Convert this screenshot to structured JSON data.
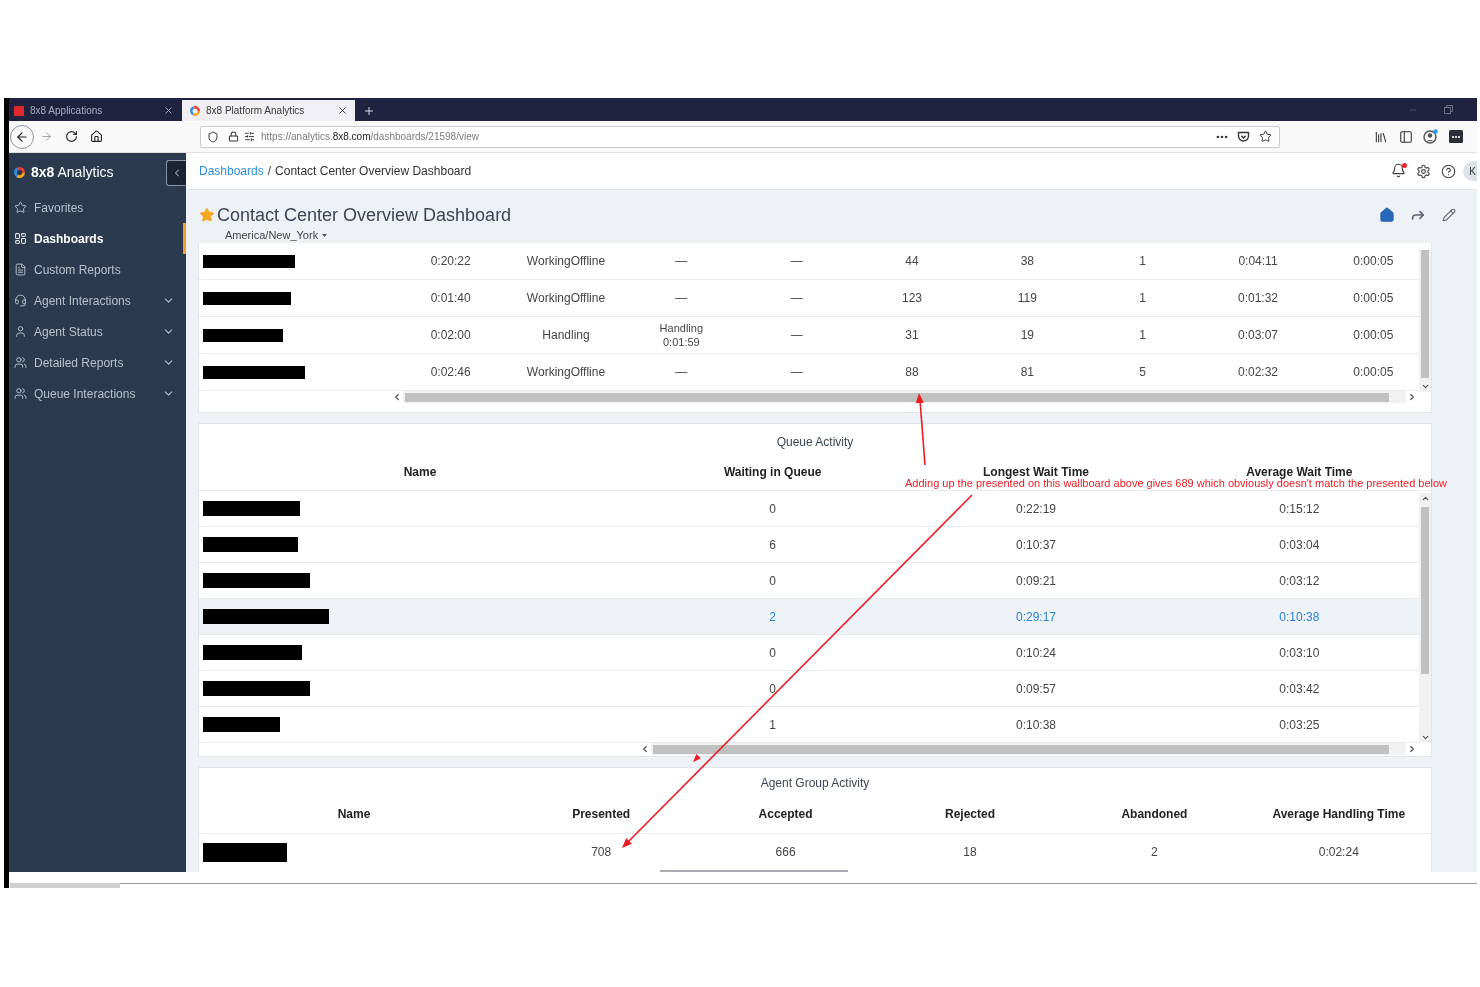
{
  "browser": {
    "tabs": [
      {
        "label": "8x8 Applications",
        "selected": false
      },
      {
        "label": "8x8 Platform Analytics",
        "selected": true
      }
    ],
    "address": {
      "prefix": "https://analytics.",
      "domain": "8x8.com",
      "path": "/dashboards/21598/view"
    }
  },
  "sidebar": {
    "logo": "**8x8** Analytics",
    "items": [
      {
        "label": "Favorites",
        "kind": "link",
        "selected": false
      },
      {
        "label": "Dashboards",
        "kind": "link",
        "selected": true
      },
      {
        "label": "Custom Reports",
        "kind": "link",
        "selected": false
      },
      {
        "label": "Agent Interactions",
        "kind": "group",
        "selected": false
      },
      {
        "label": "Agent Status",
        "kind": "group",
        "selected": false
      },
      {
        "label": "Detailed Reports",
        "kind": "group",
        "selected": false
      },
      {
        "label": "Queue Interactions",
        "kind": "group",
        "selected": false
      }
    ]
  },
  "top_bar": {
    "breadcrumb": [
      {
        "label": "Dashboards",
        "kind": "link"
      },
      {
        "label": "Contact Center Overview Dashboard",
        "kind": "current"
      }
    ],
    "separator": "/",
    "notification": true,
    "avatar": "K"
  },
  "dashboard": {
    "title": "Contact Center Overview Dashboard",
    "favorite": true,
    "timezone": "America/New_York"
  },
  "agent_table": {
    "rows": [
      {
        "cells": [
          "",
          "0:20:22",
          "WorkingOffline",
          "—",
          "—",
          "44",
          "38",
          "1",
          "0:04:11",
          "0:00:05"
        ]
      },
      {
        "cells": [
          "",
          "0:01:40",
          "WorkingOffline",
          "—",
          "—",
          "123",
          "119",
          "1",
          "0:01:32",
          "0:00:05"
        ]
      },
      {
        "cells": [
          "",
          "0:02:00",
          "Handling",
          "Handling\n0:01:59",
          "—",
          "31",
          "19",
          "1",
          "0:03:07",
          "0:00:05"
        ]
      },
      {
        "cells": [
          "",
          "0:02:46",
          "WorkingOffline",
          "—",
          "—",
          "88",
          "81",
          "5",
          "0:02:32",
          "0:00:05"
        ]
      }
    ]
  },
  "queue_activity": {
    "title": "Queue Activity",
    "columns": [
      "Name",
      "Waiting in Queue",
      "Longest Wait Time",
      "Average Wait Time"
    ],
    "rows": [
      {
        "cells": [
          "",
          "0",
          "0:22:19",
          "0:15:12"
        ],
        "highlighted": false
      },
      {
        "cells": [
          "",
          "6",
          "0:10:37",
          "0:03:04"
        ],
        "highlighted": false
      },
      {
        "cells": [
          "",
          "0",
          "0:09:21",
          "0:03:12"
        ],
        "highlighted": false
      },
      {
        "cells": [
          "",
          "2",
          "0:29:17",
          "0:10:38"
        ],
        "highlighted": true
      },
      {
        "cells": [
          "",
          "0",
          "0:10:24",
          "0:03:10"
        ],
        "highlighted": false
      },
      {
        "cells": [
          "",
          "0",
          "0:09:57",
          "0:03:42"
        ],
        "highlighted": false
      },
      {
        "cells": [
          "",
          "1",
          "0:10:38",
          "0:03:25"
        ],
        "highlighted": false
      }
    ]
  },
  "agent_group_activity": {
    "title": "Agent Group Activity",
    "columns": [
      "Name",
      "Presented",
      "Accepted",
      "Rejected",
      "Abandoned",
      "Average Handling Time"
    ],
    "rows": [
      {
        "cells": [
          "",
          "708",
          "666",
          "18",
          "2",
          "0:02:24"
        ]
      }
    ]
  },
  "annotation": {
    "text": "Adding up the presented on this wallboard above gives 689 which obviously doesn't match the presented below"
  }
}
